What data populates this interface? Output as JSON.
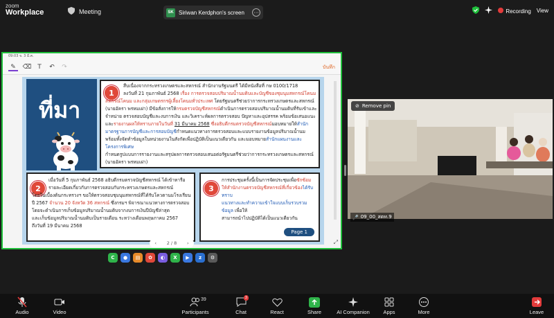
{
  "app": {
    "logo_line1": "zoom",
    "logo_line2": "Workplace",
    "meeting_label": "Meeting"
  },
  "share": {
    "initials": "SK",
    "title": "Siriwan Kerdphon's screen",
    "more": "···"
  },
  "topright": {
    "recording": "Recording",
    "view": "View"
  },
  "tablet": {
    "status": "09:03  จ. 3 มี.ค.",
    "save": "บันทึก",
    "page_indicator": "2 / 8",
    "page_button": "Page 1"
  },
  "slide": {
    "heading": "ที่มา",
    "box1": {
      "num": "1",
      "l1": "สืบเนื่องจากกระทรวงเกษตรและสหกรณ์  สำนักงานรัฐมนตรี ได้มีหนังสือที่ กษ 0100/1718",
      "l2a": "ลงวันที่ 21 กุมภาพันธ์ 2568 ",
      "l2b": "เรื่อง การตรวจสอบปริมาณน้ำนมดิบและบัญชีของชุมนุมสหกรณ์โคนม",
      "l3a": "สหกรณ์โคนม และกลุ่มเกษตรกรผู้เลี้ยงโคนมทั่วประเทศ",
      "l3b": " โดยรัฐมนตรีช่วยว่าการกระทรวงเกษตรและสหกรณ์",
      "l4a": "(นายอัครา พรหมเผ่า) มีข้อสั่งการให้",
      "l4b": "กรมตรวจบัญชีสหกรณ์",
      "l4c": "ดำเนินการตรวจสอบปริมาณน้ำนมดิบที่รับเข้าและ",
      "l5": "จำหน่าย ตรวจสอบบัญชีและงบการเงิน และวิเคราะห์ผลการตรวจสอบ ปัญหาและอุปสรรค พร้อมข้อเสนอแนะ",
      "l6a": "และ",
      "l6b": "รายงานผลให้ทราบภายในวันที่ ",
      "l6c": "31 มีนาคม 2568",
      "l6d": " ซึ่งอธิบดีกรมตรวจบัญชีสหกรณ์",
      "l6e": "มอบหมายให้",
      "l6f": "สำนัก",
      "l7a": "มาตรฐานการบัญชีและการสอบบัญชี",
      "l7b": "กำหนดแนวทางการตรวจสอบและแบบรายงานข้อมูลปริมาณน้ำนม",
      "l8a": "พร้อมทั้งจัดทำข้อมูลในหน่วยงานในสังกัดเพื่อปฏิบัติเป็นแนวเดียวกัน และมอบหมาย",
      "l8b": "สำนักแผนงานและโครงการพิเศษ",
      "l9": "กำหนดรูปแบบการรายงานและสรุปผลการตรวจสอบเสนอต่อรัฐมนตรีช่วยว่าการกระทรวงเกษตรและสหกรณ์",
      "l10": "(นายอัครา พรหมเผ่า)"
    },
    "box2": {
      "num": "2",
      "l1": "เมื่อวันที่ 5 กุมภาพันธ์ 2568 อธิบดีกรมตรวจบัญชีสหกรณ์ ได้เข้าหารือ",
      "l2": "รายละเอียดเกี่ยวกับการตรวจสอบกับกระทรวงเกษตรและสหกรณ์",
      "l3": "โดยในเบื้องต้นกระทรวงฯ ขอให้ตรวจสอบชุมนุมสหกรณ์ที่ได้รับโควตานมโรงเรียน",
      "l4a": "ปี 2567 ",
      "l4b": "จำนวน 20 จังหวัด 36 สหกรณ์",
      "l4c": " ซึ่งกรมฯ พิจารณาแนวทางการตรวจสอบ",
      "l5": "โดยจะดำเนินการเก็บข้อมูลปริมาณน้ำนมดิบจากงบการเงินปีบัญชีล่าสุด",
      "l6": "และเก็บข้อมูลปริมาณน้ำนมดิบเป็นรายเดือน ระหว่างเดือนพฤษภาคม 2567",
      "l7": "ถึงวันที่ 19 มีนาคม 2568"
    },
    "box3": {
      "num": "3",
      "l1a": "การประชุมครั้งนี้เป็นการจัดประชุมเพื่อ",
      "l1b": "ซักซ้อม",
      "l2a": "ให้สำนักงานตรวจบัญชีสหกรณ์ที่เกี่ยวข้อง",
      "l2b": "ได้รับทราบ",
      "l3a": "แนวทางและทำความเข้าใจแบบเก็บรวบรวมข้อมูล",
      "l3b": " เพื่อให้",
      "l4": "สามารถนำไปปฏิบัติได้เป็นแนวเดียวกัน"
    }
  },
  "video": {
    "remove_pin": "Remove pin",
    "name": "09_00_สตท.9"
  },
  "bottombar": {
    "audio": "Audio",
    "video": "Video",
    "participants": "Participants",
    "participants_count": "39",
    "chat": "Chat",
    "chat_badge": "3",
    "react": "React",
    "share": "Share",
    "ai": "AI Companion",
    "apps": "Apps",
    "more": "More",
    "leave": "Leave"
  },
  "colors": {
    "share_border": "#1fbf3b",
    "slide_bg": "#b7d5ec",
    "accent_red": "#e0483a",
    "recording_dot": "#e23b3b"
  }
}
